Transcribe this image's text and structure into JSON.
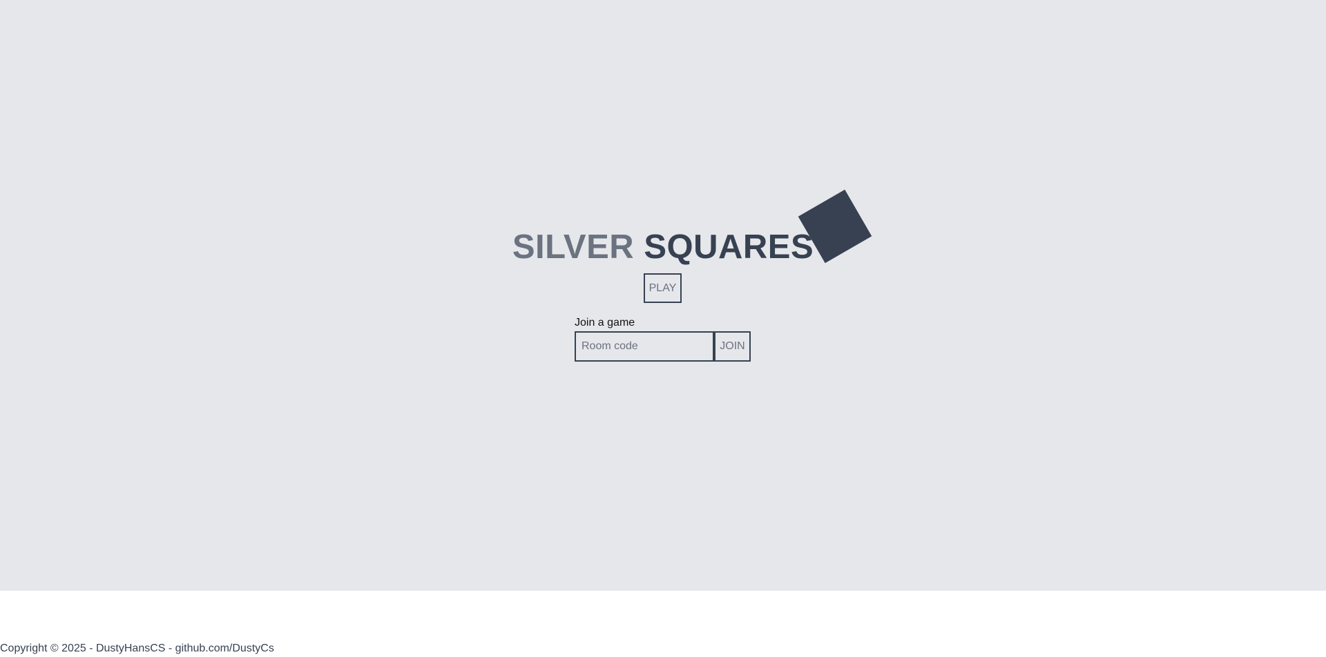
{
  "header": {
    "title_part1": "SILVER",
    "title_part2": "SQUARES",
    "logo_icon": "rotated-square"
  },
  "actions": {
    "play_label": "PLAY"
  },
  "join": {
    "label": "Join a game",
    "placeholder": "Room code",
    "value": "",
    "button_label": "JOIN"
  },
  "footer": {
    "copyright": "Copyright © 2025 - DustyHansCS - github.com/DustyCs"
  },
  "colors": {
    "background": "#e5e7eb",
    "primary": "#374151",
    "secondary": "#6b7280",
    "footer_background": "#ffffff"
  }
}
